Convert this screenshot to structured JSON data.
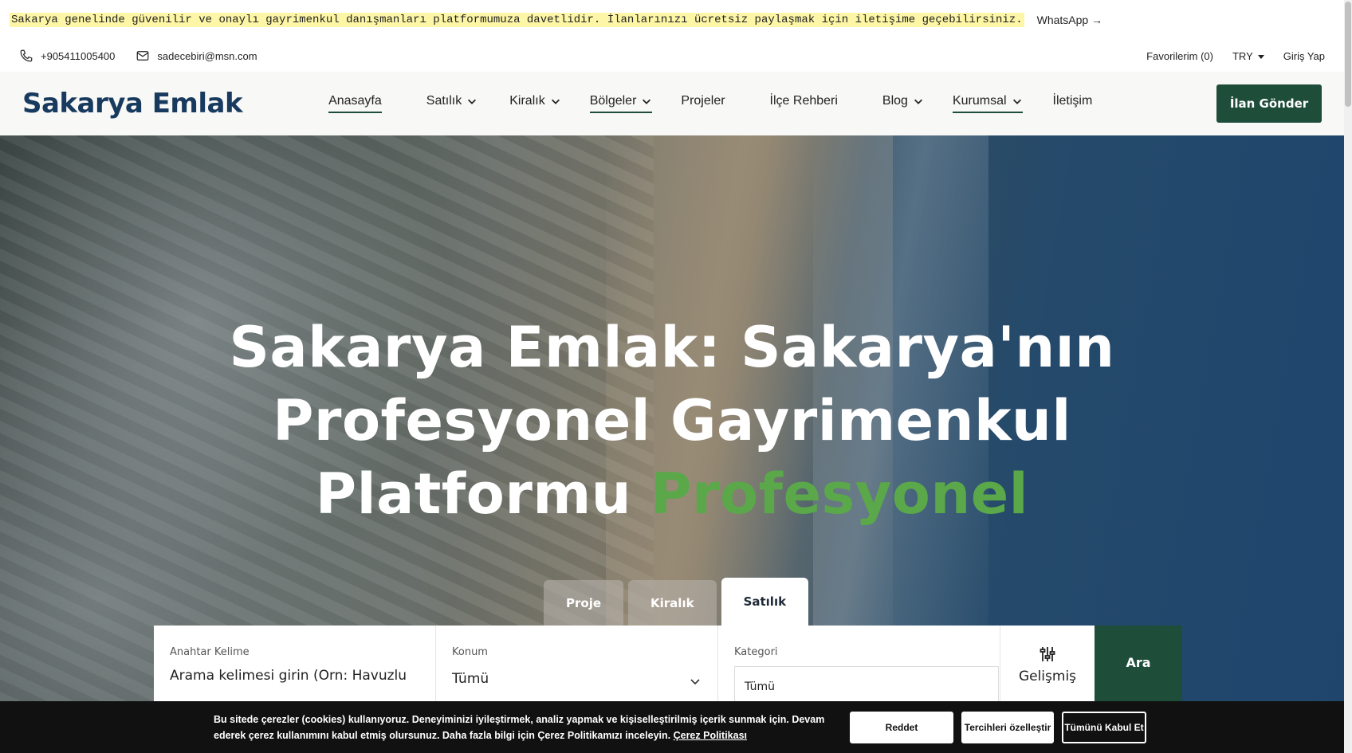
{
  "announcement": {
    "text": "Sakarya genelinde güvenilir ve onaylı gayrimenkul danışmanları platformumuza davetlidir. İlanlarınızı ücretsiz paylaşmak için iletişime geçebilirsiniz.",
    "link": "WhatsApp →"
  },
  "contact": {
    "phone": "+905411005400",
    "email": "sadecebiri@msn.com",
    "favorites": "Favorilerim (0)",
    "currency": "TRY",
    "login": "Giriş Yap"
  },
  "header": {
    "logo": "Sakarya Emlak",
    "cta": "İlan Gönder",
    "nav": [
      {
        "label": "Anasayfa"
      },
      {
        "label": "Satılık"
      },
      {
        "label": "Kiralık"
      },
      {
        "label": "Bölgeler"
      },
      {
        "label": "Projeler"
      },
      {
        "label": "İlçe Rehberi"
      },
      {
        "label": "Blog"
      },
      {
        "label": "Kurumsal"
      },
      {
        "label": "İletişim"
      }
    ]
  },
  "hero": {
    "line1": "Sakarya Emlak: Sakarya'nın",
    "line2": "Profesyonel Gayrimenkul",
    "line3": "Platformu",
    "accent": "Profesyonel",
    "accent_color": "#5aa84a"
  },
  "search": {
    "tabs": [
      "Proje",
      "Kiralık",
      "Satılık"
    ],
    "active_tab": "Satılık",
    "keyword_label": "Anahtar Kelime",
    "keyword_placeholder": "Arama kelimesi girin (Orn: Havuzlu",
    "location_label": "Konum",
    "location_value": "Tümü",
    "category_label": "Kategori",
    "category_value": "Tümü",
    "advanced": "Gelişmiş",
    "submit": "Ara"
  },
  "cookie": {
    "line1": "Bu sitede çerezler (cookies) kullanıyoruz. Deneyiminizi iyileştirmek, analiz yapmak ve kişiselleştirilmiş içerik sunmak için. Devam",
    "line2": "ederek çerez kullanımını kabul etmiş olursunuz. Daha fazla bilgi için Çerez Politikamızı inceleyin.",
    "policy_link": "Çerez Politikası",
    "reject": "Reddet",
    "customize": "Tercihleri özelleştir",
    "accept_all": "Tümünü Kabul Et"
  },
  "colors": {
    "brand_green": "#1e4d3a",
    "logo_navy": "#173a5e",
    "announcement_highlight": "#fdf6a6"
  }
}
